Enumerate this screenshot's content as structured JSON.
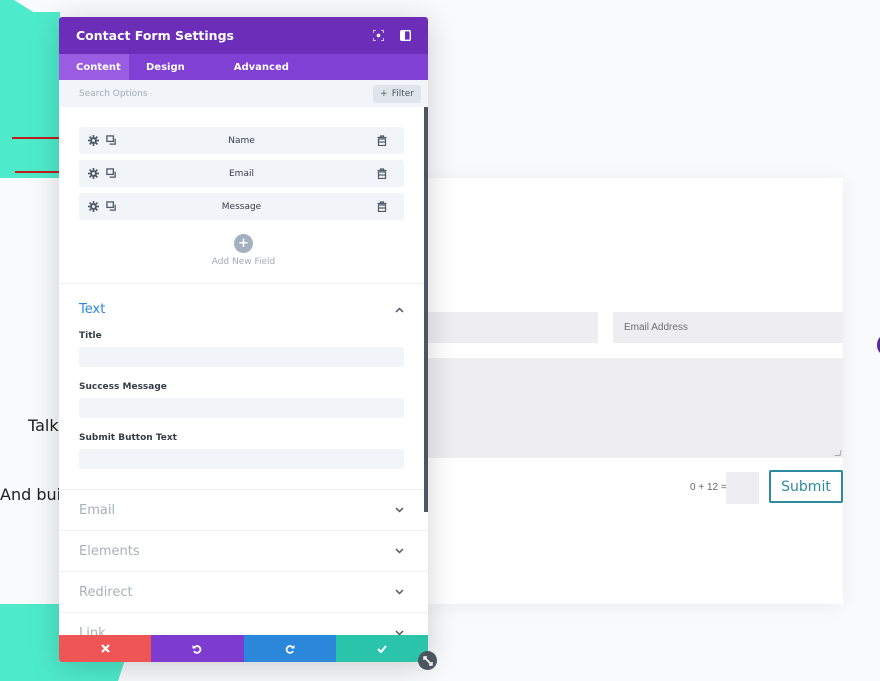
{
  "background": {
    "text_line_1": "Talk",
    "text_line_2": "And buil",
    "accent_teal": "#4eebcb"
  },
  "modal": {
    "title": "Contact Form Settings",
    "header_icons": [
      "focus-icon",
      "split-view-icon"
    ],
    "tabs": [
      {
        "label": "Content",
        "active": true
      },
      {
        "label": "Design",
        "active": false
      },
      {
        "label": "Advanced",
        "active": false
      }
    ],
    "search": {
      "placeholder": "Search Options",
      "filter_label": "Filter"
    },
    "fields": [
      {
        "label": "Name"
      },
      {
        "label": "Email"
      },
      {
        "label": "Message"
      }
    ],
    "add_field_label": "Add New Field",
    "text_section": {
      "title": "Text",
      "options": [
        {
          "label": "Title",
          "value": ""
        },
        {
          "label": "Success Message",
          "value": ""
        },
        {
          "label": "Submit Button Text",
          "value": ""
        }
      ]
    },
    "collapsed_sections": [
      {
        "title": "Email"
      },
      {
        "title": "Elements"
      },
      {
        "title": "Redirect"
      },
      {
        "title": "Link"
      }
    ],
    "footer": {
      "cancel": "cancel",
      "undo": "undo",
      "redo": "redo",
      "save": "save"
    },
    "colors": {
      "header": "#6c2eb9",
      "tabs": "#8040d4",
      "active_tab": "#9a5ce3",
      "cancel": "#ef5555",
      "undo": "#7e3bd0",
      "redo": "#2b87da",
      "save": "#29c4a9"
    }
  },
  "preview": {
    "name_placeholder": "",
    "email_placeholder": "Email Address",
    "message_placeholder": "",
    "captcha_question": "0 + 12 =",
    "captcha_value": "",
    "submit_label": "Submit"
  }
}
